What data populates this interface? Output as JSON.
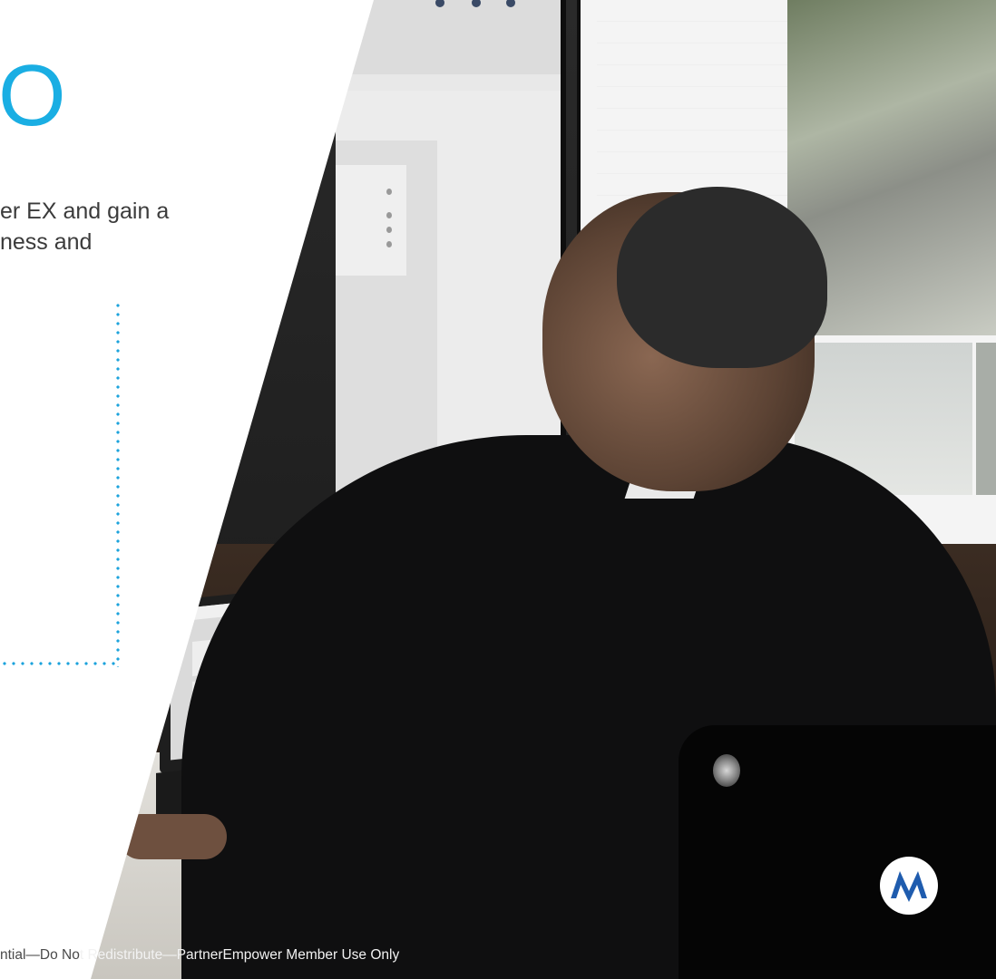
{
  "title_glyph": "O",
  "intro": {
    "line1": "er EX and gain a",
    "line2": "ness and"
  },
  "footer": {
    "text_light_part": "ntial—Do No",
    "text_dark_part": "t Redistribute—PartnerEmpower Member Use Only"
  },
  "colors": {
    "accent": "#1aaee3",
    "dotted_line": "#1ca3dc",
    "body_text": "#3b3b3b",
    "panel": "#ffffff"
  },
  "icons": {
    "brand_logo": "motorola-batwing-logo"
  }
}
